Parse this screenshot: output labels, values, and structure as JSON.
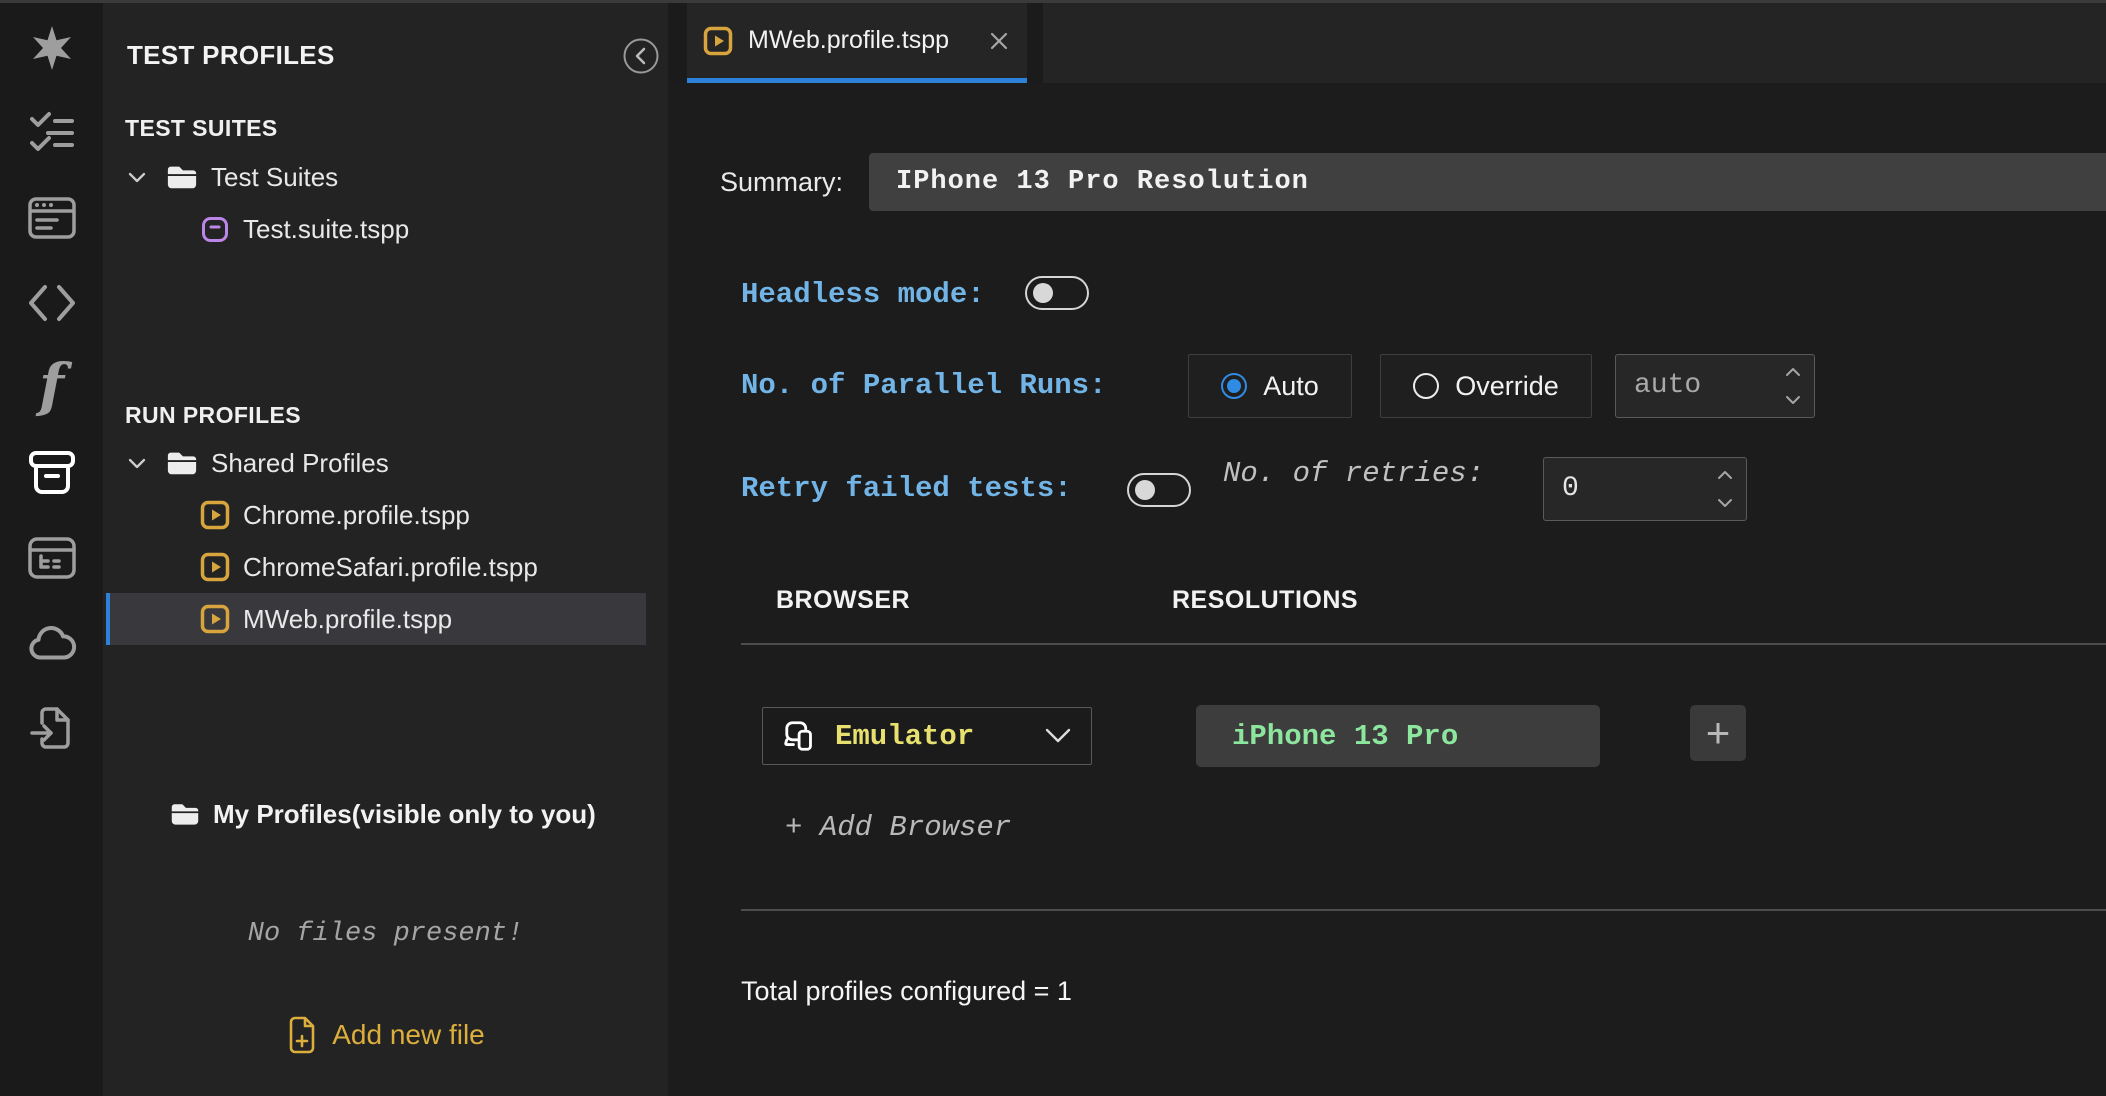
{
  "activity_bar": {
    "icons": [
      {
        "name": "logo-burst",
        "active": false
      },
      {
        "name": "checklist",
        "active": false
      },
      {
        "name": "browser-window",
        "active": false
      },
      {
        "name": "code-brackets",
        "active": false
      },
      {
        "name": "function",
        "active": false,
        "glyph": "f"
      },
      {
        "name": "archive-box",
        "active": true
      },
      {
        "name": "window-tree",
        "active": false
      },
      {
        "name": "cloud",
        "active": false
      },
      {
        "name": "file-import",
        "active": false
      }
    ]
  },
  "sidebar": {
    "title": "TEST PROFILES",
    "test_suites": {
      "header": "TEST SUITES",
      "folder_label": "Test Suites",
      "file_label": "Test.suite.tspp"
    },
    "run_profiles": {
      "header": "RUN PROFILES",
      "folder_label": "Shared Profiles",
      "files": [
        {
          "label": "Chrome.profile.tspp",
          "selected": false
        },
        {
          "label": "ChromeSafari.profile.tspp",
          "selected": false
        },
        {
          "label": "MWeb.profile.tspp",
          "selected": true
        }
      ]
    },
    "my_profiles_label": "My Profiles(visible only to you)",
    "empty_message": "No files present!",
    "add_file_label": "Add new file"
  },
  "tab": {
    "label": "MWeb.profile.tspp"
  },
  "editor": {
    "summary": {
      "label": "Summary:",
      "value": "IPhone 13 Pro Resolution"
    },
    "headless": {
      "label": "Headless mode:",
      "enabled": false
    },
    "parallel": {
      "label": "No. of Parallel Runs:",
      "options": [
        "Auto",
        "Override"
      ],
      "selected": "Auto",
      "value": "auto"
    },
    "retry": {
      "label": "Retry failed tests:",
      "enabled": false,
      "retries_label": "No. of retries:",
      "retries_value": "0"
    },
    "table": {
      "headers": [
        "BROWSER",
        "RESOLUTIONS"
      ]
    },
    "browser_row": {
      "browser": "Emulator",
      "resolution": "iPhone 13 Pro",
      "add_button": "+"
    },
    "add_browser_label": "+ Add Browser",
    "total_label": "Total profiles configured = 1"
  },
  "colors": {
    "accent-blue": "#2e81d9",
    "label-blue": "#72b4e6",
    "gold-text": "#dcae3c",
    "yellow-text": "#e8e06e",
    "green-text": "#8de69e",
    "purple": "#bb86e8",
    "selection-bg": "#38383d"
  }
}
